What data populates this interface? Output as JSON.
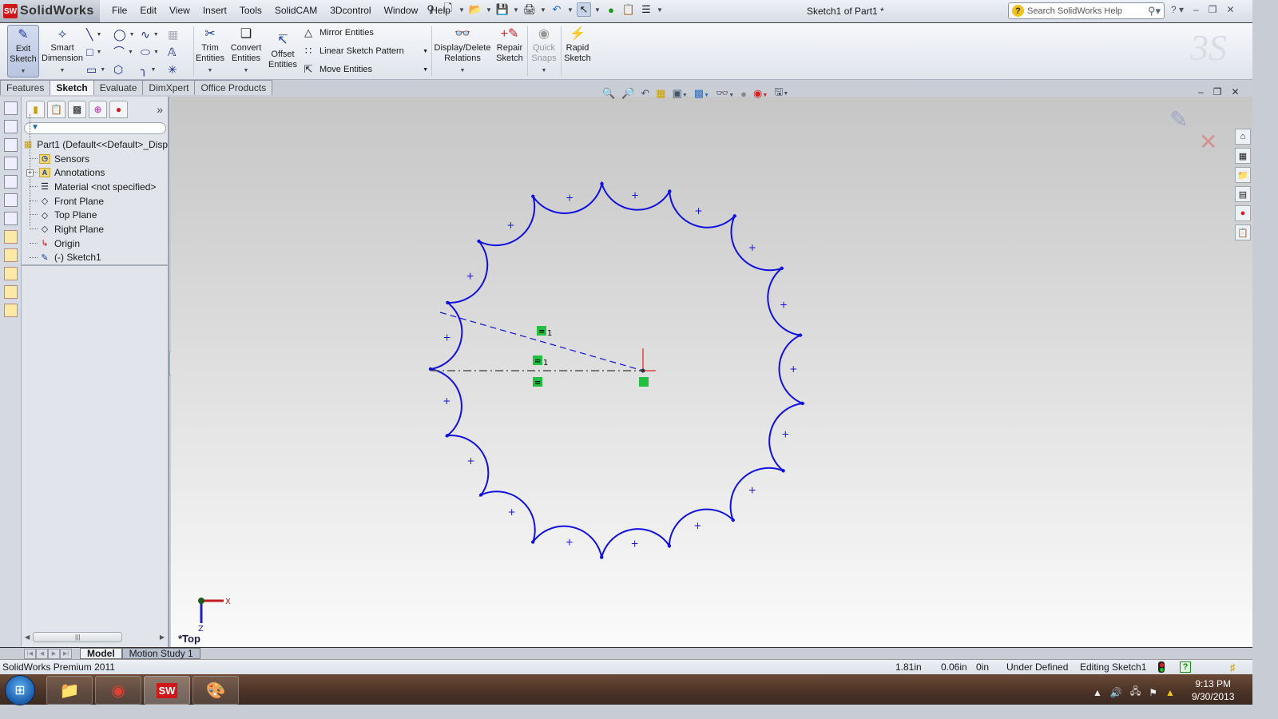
{
  "app": {
    "logo_text": "SolidWorks",
    "document_title": "Sketch1 of Part1 *",
    "search_placeholder": "Search SolidWorks Help"
  },
  "menu": [
    "File",
    "Edit",
    "View",
    "Insert",
    "Tools",
    "SolidCAM",
    "3Dcontrol",
    "Window",
    "Help"
  ],
  "quick_access": [
    "new-document",
    "open",
    "save",
    "print",
    "undo",
    "select",
    "rebuild",
    "file-properties",
    "options"
  ],
  "ribbon": {
    "exit_sketch": "Exit\nSketch",
    "exit_sketch_l1": "Exit",
    "exit_sketch_l2": "Sketch",
    "smart_dim_l1": "Smart",
    "smart_dim_l2": "Dimension",
    "trim_l1": "Trim",
    "trim_l2": "Entities",
    "convert_l1": "Convert",
    "convert_l2": "Entities",
    "offset_l1": "Offset",
    "offset_l2": "Entities",
    "mirror": "Mirror Entities",
    "linear_pattern": "Linear Sketch Pattern",
    "move": "Move Entities",
    "display_delete_l1": "Display/Delete",
    "display_delete_l2": "Relations",
    "repair_l1": "Repair",
    "repair_l2": "Sketch",
    "quick_snaps_l1": "Quick",
    "quick_snaps_l2": "Snaps",
    "rapid_l1": "Rapid",
    "rapid_l2": "Sketch"
  },
  "command_tabs": [
    {
      "label": "Features",
      "active": false
    },
    {
      "label": "Sketch",
      "active": true
    },
    {
      "label": "Evaluate",
      "active": false
    },
    {
      "label": "DimXpert",
      "active": false
    },
    {
      "label": "Office Products",
      "active": false
    }
  ],
  "feature_tree": {
    "root": "Part1  (Default<<Default>_Disp",
    "items": [
      {
        "label": "Sensors",
        "icon": "sensors-folder-icon"
      },
      {
        "label": "Annotations",
        "icon": "annotations-folder-icon",
        "expandable": true
      },
      {
        "label": "Material <not specified>",
        "icon": "material-icon"
      },
      {
        "label": "Front Plane",
        "icon": "plane-icon"
      },
      {
        "label": "Top Plane",
        "icon": "plane-icon"
      },
      {
        "label": "Right Plane",
        "icon": "plane-icon"
      },
      {
        "label": "Origin",
        "icon": "origin-icon"
      },
      {
        "label": "(-) Sketch1",
        "icon": "sketch-icon"
      }
    ]
  },
  "viewport": {
    "view_label": "*Top",
    "axis_x": "X",
    "axis_z": "Z",
    "relation_badge_1": "1",
    "relation_badge_2": "1"
  },
  "bottom_tabs": [
    {
      "label": "Model",
      "active": true
    },
    {
      "label": "Motion Study 1",
      "active": false
    }
  ],
  "status": {
    "product": "SolidWorks Premium 2011",
    "x": "1.81in",
    "y": "0.06in",
    "z": "0in",
    "sketch_state": "Under Defined",
    "mode": "Editing Sketch1"
  },
  "taskbar": {
    "time": "9:13 PM",
    "date": "9/30/2013"
  },
  "colors": {
    "sketch": "#1010e0",
    "relation_badge": "#22c040",
    "origin_red": "#e02020"
  }
}
